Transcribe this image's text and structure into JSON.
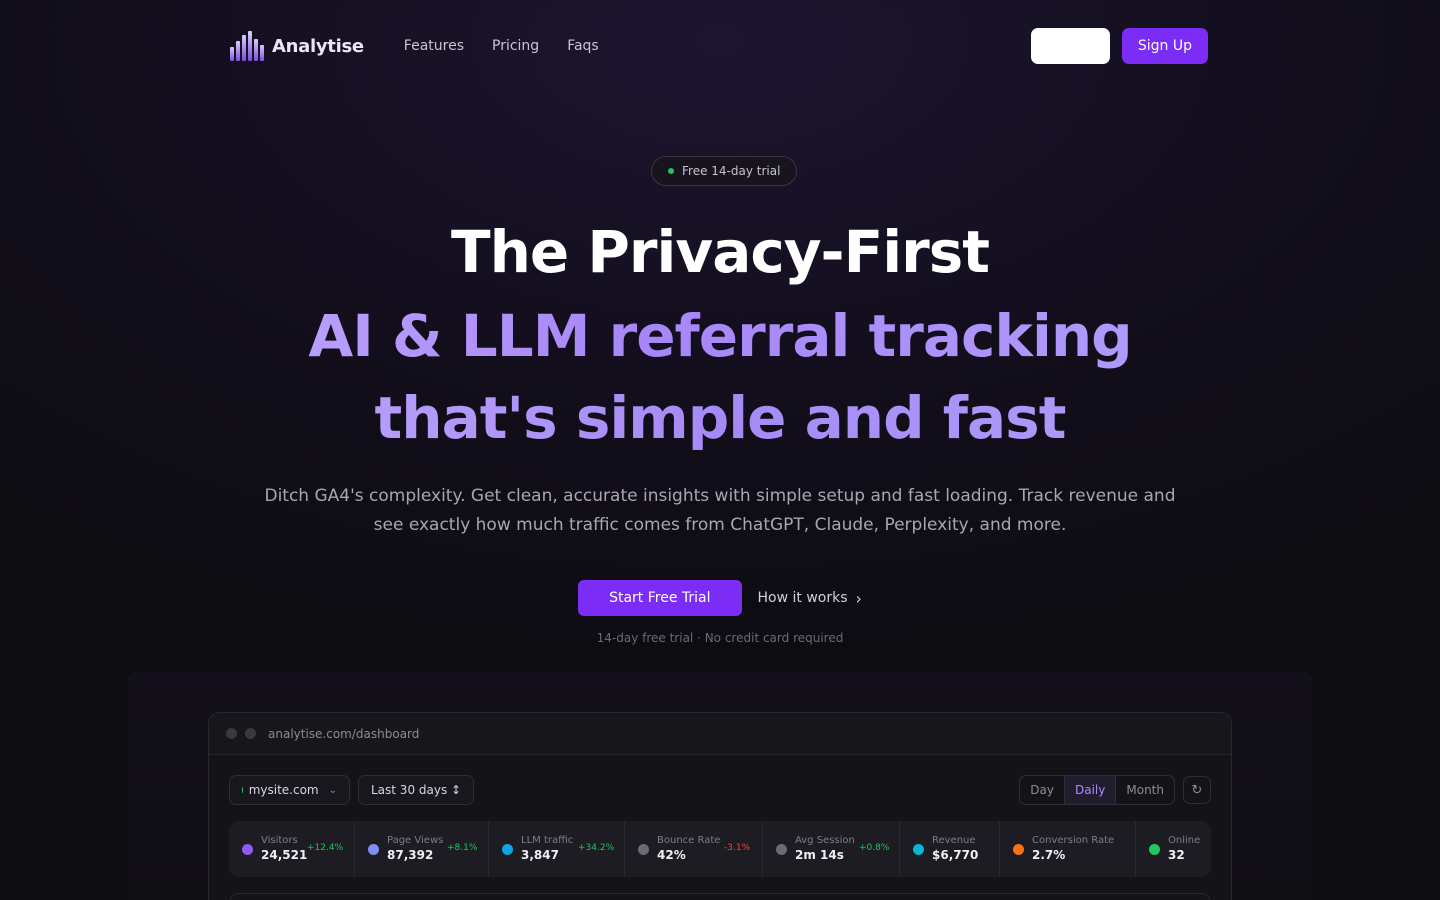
{
  "nav": {
    "brand": "Analytise",
    "links": [
      "Features",
      "Pricing",
      "Faqs"
    ],
    "signup_label": "Sign Up"
  },
  "hero": {
    "badge": "Free 14-day trial",
    "line1": "The Privacy-First",
    "line2": "AI & LLM referral tracking",
    "line3": "that's simple and fast",
    "lead": "Ditch GA4's complexity. Get clean, accurate insights with simple setup and fast loading. Track revenue and see exactly how much traffic comes from ChatGPT, Claude, Perplexity, and more.",
    "cta_primary": "Start Free Trial",
    "cta_secondary": "How it works",
    "fineprint": "14-day free trial · No credit card required"
  },
  "dashboard": {
    "url": "analytise.com/dashboard",
    "site_select": "mysite.com",
    "range_select": "Last 30 days ↕",
    "granularity": [
      "Day",
      "Daily",
      "Month"
    ],
    "granularity_active": "Daily",
    "stats": [
      {
        "label": "Visitors",
        "value": "24,521",
        "delta": "+12.4%",
        "trend": "up",
        "color": "#8b5cf6"
      },
      {
        "label": "Page Views",
        "value": "87,392",
        "delta": "+8.1%",
        "trend": "up",
        "color": "#818cf8"
      },
      {
        "label": "LLM traffic",
        "value": "3,847",
        "delta": "+34.2%",
        "trend": "up",
        "color": "#0ea5e9"
      },
      {
        "label": "Bounce Rate",
        "value": "42%",
        "delta": "-3.1%",
        "trend": "down",
        "color": "#6b6b73"
      },
      {
        "label": "Avg Session",
        "value": "2m 14s",
        "delta": "+0.8%",
        "trend": "up",
        "color": "#6b6b73"
      },
      {
        "label": "Revenue",
        "value": "$6,770",
        "delta": "",
        "trend": "",
        "color": "#06b6d4"
      },
      {
        "label": "Conversion Rate",
        "value": "2.7%",
        "delta": "",
        "trend": "",
        "color": "#f97316"
      },
      {
        "label": "Online",
        "value": "32",
        "delta": "",
        "trend": "",
        "color": "#22c55e"
      }
    ]
  }
}
